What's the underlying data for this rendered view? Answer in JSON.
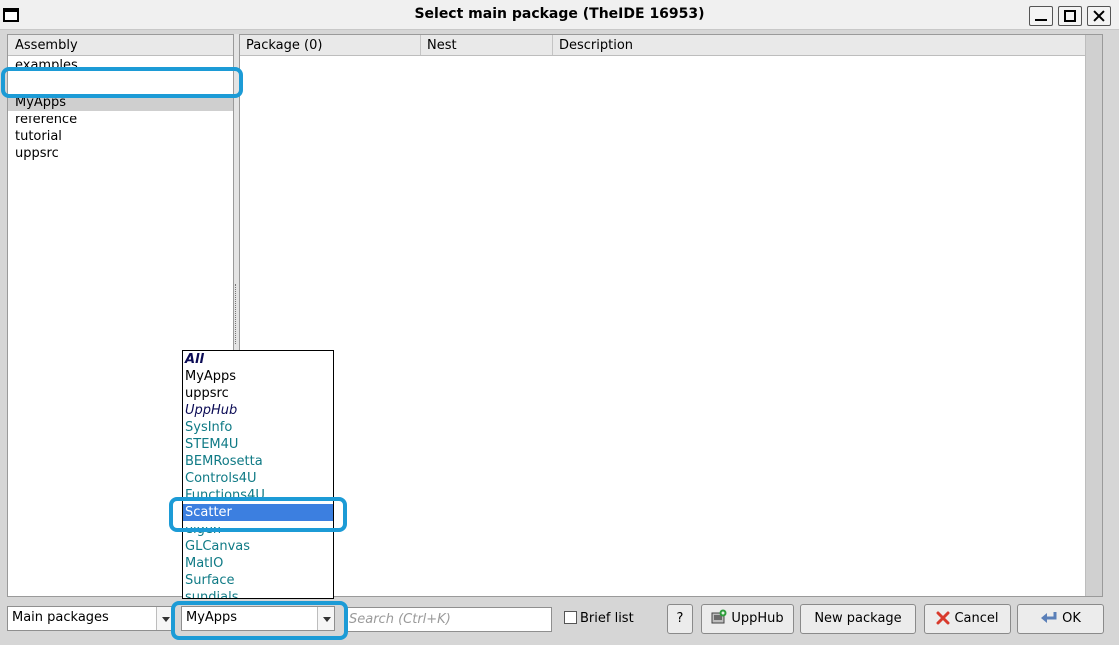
{
  "window": {
    "title": "Select main package (TheIDE 16953)"
  },
  "assembly": {
    "header": "Assembly",
    "items": [
      {
        "label": "examples"
      },
      {
        "label": "MyApps"
      },
      {
        "label": "reference"
      },
      {
        "label": "tutorial"
      },
      {
        "label": "uppsrc"
      }
    ],
    "selected": "MyApps"
  },
  "packages": {
    "columns": [
      "Package (0)",
      "Nest",
      "Description"
    ],
    "rows": []
  },
  "dropdown": {
    "items": [
      {
        "label": "All",
        "style": "dark italic bold"
      },
      {
        "label": "MyApps",
        "style": "black"
      },
      {
        "label": "uppsrc",
        "style": "black"
      },
      {
        "label": "UppHub",
        "style": "dark italic"
      },
      {
        "label": "SysInfo",
        "style": "teal"
      },
      {
        "label": "STEM4U",
        "style": "teal"
      },
      {
        "label": "BEMRosetta",
        "style": "teal"
      },
      {
        "label": "Controls4U",
        "style": "teal"
      },
      {
        "label": "Functions4U",
        "style": "teal"
      },
      {
        "label": "Scatter",
        "style": "teal"
      },
      {
        "label": "eigen",
        "style": "teal"
      },
      {
        "label": "GLCanvas",
        "style": "teal"
      },
      {
        "label": "MatIO",
        "style": "teal"
      },
      {
        "label": "Surface",
        "style": "teal"
      },
      {
        "label": "sundials",
        "style": "teal"
      }
    ],
    "selected": "Scatter"
  },
  "bottom": {
    "filter_select": "Main packages",
    "nest_select": "MyApps",
    "search_placeholder": "Search (Ctrl+K)",
    "brief_list_label": "Brief list",
    "help_label": "?",
    "upphub_label": "UppHub",
    "new_package_label": "New package",
    "cancel_label": "Cancel",
    "ok_label": "OK"
  },
  "colors": {
    "annotation": "#1c9bd6",
    "selection": "#3c7fe0",
    "nest_teal": "#0f7a85"
  }
}
